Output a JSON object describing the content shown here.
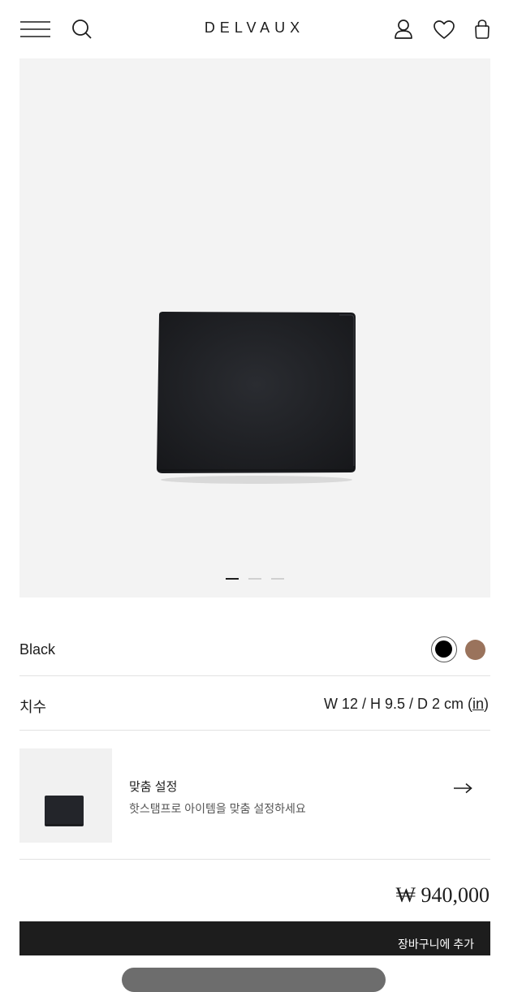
{
  "header": {
    "brand": "DELVAUX",
    "icons": [
      "menu-icon",
      "search-icon",
      "account-icon",
      "wishlist-heart-icon",
      "shopping-bag-icon"
    ]
  },
  "gallery": {
    "slide_count": 3,
    "active_slide": 1
  },
  "product": {
    "color_name": "Black",
    "swatches": [
      {
        "name": "black",
        "color": "#000000",
        "selected": true
      },
      {
        "name": "brown",
        "color": "#9a735c",
        "selected": false
      }
    ],
    "size_label": "치수",
    "size_value": "W 12 / H 9.5 / D 2 cm (",
    "size_unit": "in",
    "size_close": ")"
  },
  "personalization": {
    "title": "맞춤 설정",
    "subtitle": "핫스탬프로 아이템을 맞춤 설정하세요"
  },
  "price": "₩ 940,000",
  "cart": {
    "label": "장바구니에 추가"
  },
  "colors": {
    "text": "#1d1d1d",
    "gallery_bg": "#f3f3f3",
    "cart_bg": "#1d1d1d",
    "divider": "#e2e2e2"
  }
}
